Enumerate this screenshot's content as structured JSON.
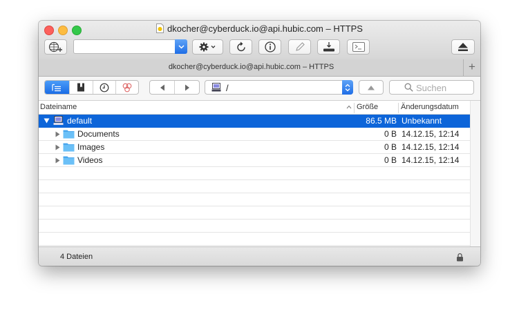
{
  "window": {
    "title": "dkocher@cyberduck.io@api.hubic.com – HTTPS"
  },
  "toolbar": {
    "quick_connect_value": ""
  },
  "tab": {
    "label": "dkocher@cyberduck.io@api.hubic.com – HTTPS",
    "add_label": "+"
  },
  "nav": {
    "path": "/",
    "search_placeholder": "Suchen"
  },
  "columns": {
    "name": "Dateiname",
    "size": "Größe",
    "modified": "Änderungsdatum"
  },
  "files": [
    {
      "name": "default",
      "size": "86.5 MB",
      "modified": "Unbekannt",
      "expanded": true,
      "selected": true,
      "icon": "drive-icon"
    },
    {
      "name": "Documents",
      "size": "0 B",
      "modified": "14.12.15, 12:14",
      "icon": "folder-icon"
    },
    {
      "name": "Images",
      "size": "0 B",
      "modified": "14.12.15, 12:14",
      "icon": "folder-icon"
    },
    {
      "name": "Videos",
      "size": "0 B",
      "modified": "14.12.15, 12:14",
      "icon": "folder-icon"
    }
  ],
  "status": {
    "text": "4 Dateien"
  },
  "colors": {
    "selection": "#0d65d9",
    "folder": "#5ab4f2",
    "accent": "#1f6ee6"
  }
}
